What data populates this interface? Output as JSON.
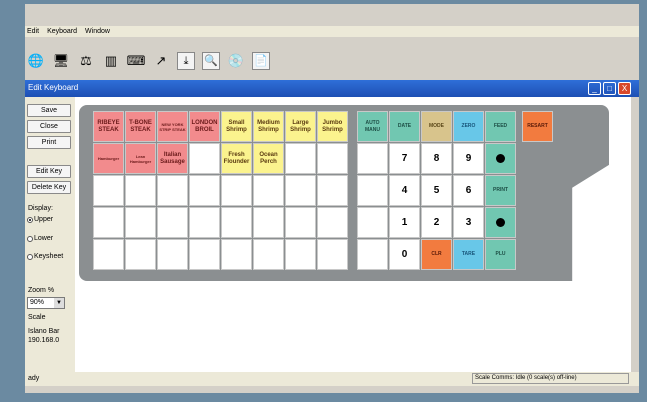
{
  "menu": [
    "Edit",
    "Keyboard",
    "Window"
  ],
  "toolbar_icons": [
    "globe-icon",
    "monitor-icon",
    "scale-icon",
    "barcode-icon",
    "keyboard-layout-icon",
    "send-icon",
    "download-icon",
    "zoom-icon",
    "disc-icon",
    "document-icon"
  ],
  "window": {
    "title": "Edit Keyboard",
    "minimize": "_",
    "maximize": "□",
    "close": "X"
  },
  "panel": {
    "save": "Save",
    "close": "Close",
    "print": "Print",
    "edit_key": "Edit Key",
    "delete_key": "Delete Key",
    "display_label": "Display:",
    "display_options": [
      "Upper",
      "Lower",
      "Keysheet"
    ],
    "selected_display": "Upper",
    "zoom_label": "Zoom %",
    "zoom_value": "90%",
    "scale_label": "Scale",
    "scale_name": "Islano Bar",
    "scale_ip": "190.168.0"
  },
  "keys": {
    "ribeye": "RIBEYE STEAK",
    "tbone": "T-BONE STEAK",
    "nystrip": "NEW YORK STRIP STEAK",
    "london": "LONDON BROIL",
    "small_shrimp": "Small Shrimp",
    "medium_shrimp": "Medium Shrimp",
    "large_shrimp": "Large Shrimp",
    "jumbo_shrimp": "Jumbo Shrimp",
    "hamburger": "Hamburger",
    "lean_hamburger": "Lean Hamburger",
    "italian_sausage": "Italian Sausage",
    "fresh_flounder": "Fresh Flounder",
    "ocean_perch": "Ocean Perch",
    "auto_manu": "AUTO MANU",
    "date": "DATE",
    "mode": "MODE",
    "zero": "ZERO",
    "feed": "FEED",
    "restart": "RESART",
    "print": "PRINT",
    "clr": "CLR",
    "tare": "TARE",
    "plu": "PLU",
    "n7": "7",
    "n8": "8",
    "n9": "9",
    "n4": "4",
    "n5": "5",
    "n6": "6",
    "n1": "1",
    "n2": "2",
    "n3": "3",
    "n0": "0"
  },
  "colors": {
    "meat_keys": "#f28b8d",
    "seafood_keys": "#fbf38e",
    "function_keys": "#71c7b1",
    "mode_key": "#d8c48c",
    "zero_tare_keys": "#68c7e8",
    "clr_restart_keys": "#f27b3f",
    "keyboard_frame": "#8b8f91",
    "title_bar": "#2f6fd8"
  },
  "status": {
    "left": "ady",
    "right": "Scale Comms: Idle (0 scale(s) off-line)"
  }
}
